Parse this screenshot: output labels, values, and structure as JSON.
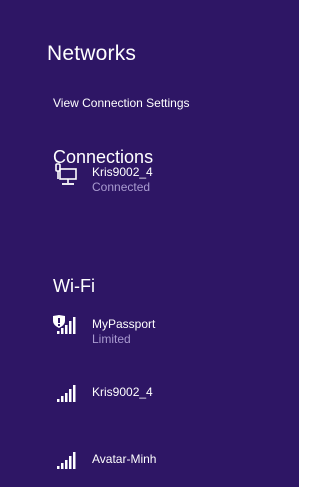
{
  "panel": {
    "title": "Networks",
    "settings_link": "View Connection Settings"
  },
  "connections": {
    "heading": "Connections",
    "items": [
      {
        "name": "Kris9002_4",
        "status": "Connected",
        "icon": "wired-network-icon"
      }
    ]
  },
  "wifi": {
    "heading": "Wi-Fi",
    "items": [
      {
        "name": "MyPassport",
        "status": "Limited",
        "icon": "wifi-signal-shield-icon"
      },
      {
        "name": "Kris9002_4",
        "status": "",
        "icon": "wifi-signal-icon"
      },
      {
        "name": "Avatar-Minh",
        "status": "",
        "icon": "wifi-signal-icon"
      }
    ]
  },
  "colors": {
    "background": "#2e1665",
    "text": "#ffffff",
    "secondary_text": "#a99bd0"
  }
}
